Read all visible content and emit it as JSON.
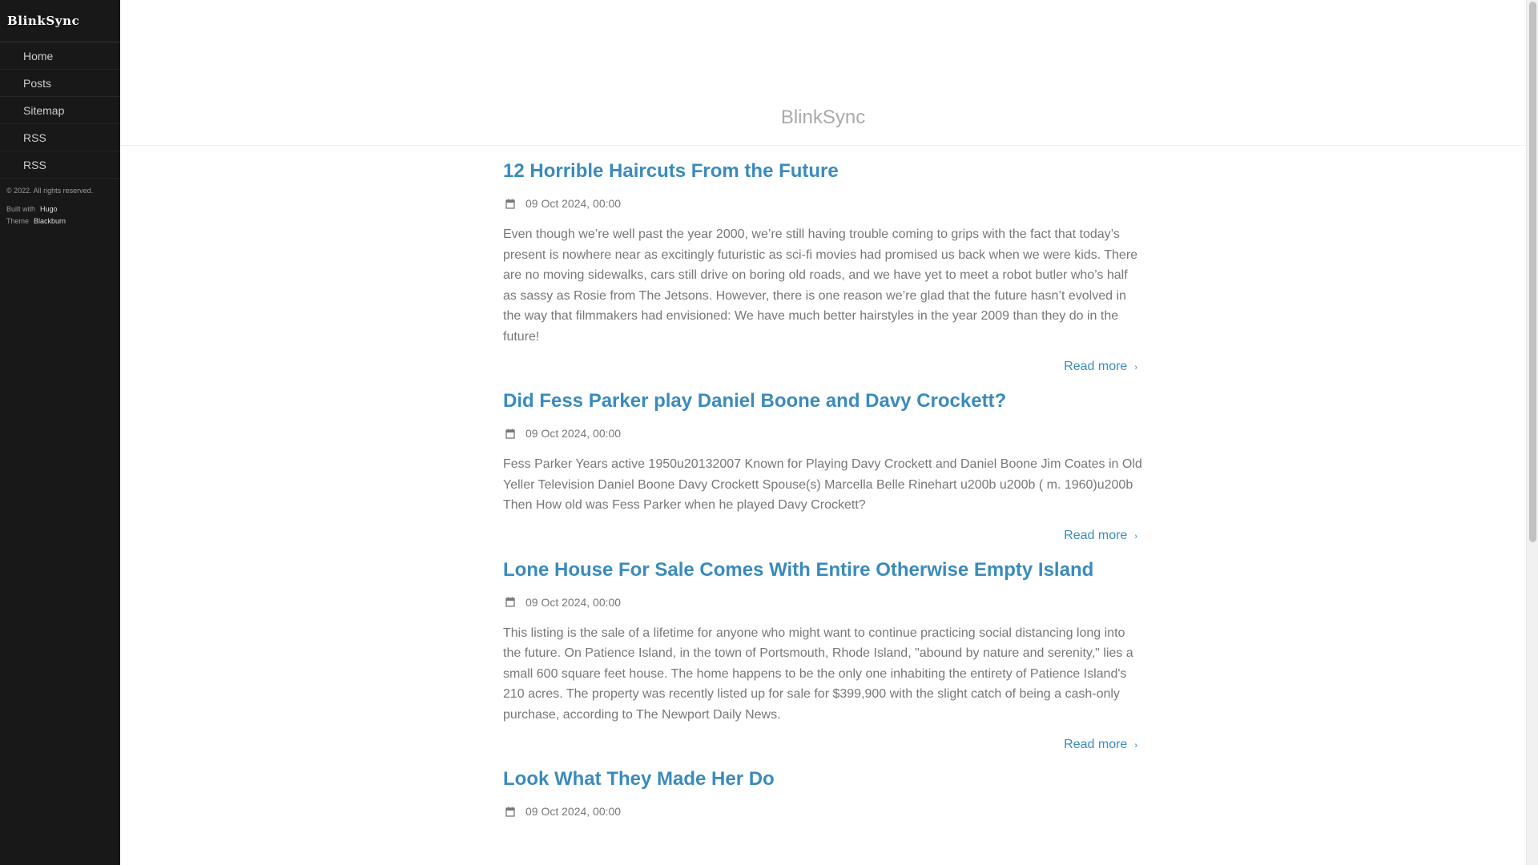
{
  "sidebar": {
    "brand": "BlinkSync",
    "items": [
      {
        "label": "Home",
        "icon": "home-icon"
      },
      {
        "label": "Posts",
        "icon": "list-icon"
      },
      {
        "label": "Sitemap",
        "icon": "sitemap-icon"
      },
      {
        "label": "RSS",
        "icon": "rss-icon"
      },
      {
        "label": "RSS",
        "icon": "rss-icon"
      }
    ],
    "footer": {
      "copyright": "© 2022. All rights reserved.",
      "built_with_label": "Built with",
      "built_with_link": "Hugo",
      "theme_label": "Theme",
      "theme_link": "Blackburn"
    }
  },
  "header": {
    "title": "BlinkSync"
  },
  "posts": [
    {
      "title": "12 Horrible Haircuts From the Future",
      "date": "09 Oct 2024, 00:00",
      "summary": "Even though we’re well past the year 2000, we’re still having trouble coming to grips with the fact that today’s present is nowhere near as excitingly futuristic as sci-fi movies had promised us back when we were kids. There are no moving sidewalks, cars still drive on boring old roads, and we have yet to meet a robot butler who’s half as sassy as Rosie from The Jetsons. However, there is one reason we’re glad that the future hasn’t evolved in the way that filmmakers had envisioned: We have much better hairstyles in the year 2009 than they do in the future!",
      "read_more": "Read more"
    },
    {
      "title": "Did Fess Parker play Daniel Boone and Davy Crockett?",
      "date": "09 Oct 2024, 00:00",
      "summary": "Fess Parker Years active 1950u20132007 Known for Playing Davy Crockett and Daniel Boone Jim Coates in Old Yeller Television Daniel Boone Davy Crockett Spouse(s) Marcella Belle Rinehart u200b u200b ( m. 1960)u200b Then How old was Fess Parker when he played Davy Crockett?",
      "read_more": "Read more"
    },
    {
      "title": "Lone House For Sale Comes With Entire Otherwise Empty Island",
      "date": "09 Oct 2024, 00:00",
      "summary": "This listing is the sale of a lifetime for anyone who might want to continue practicing social distancing long into the future. On Patience Island, in the town of Portsmouth, Rhode Island, \"abound by nature and serenity,\" lies a small 600 square feet house. The home happens to be the only one inhabiting the entirety of Patience Island's 210 acres. The property was recently listed up for sale for $399,900 with the slight catch of being a cash-only purchase, according to The Newport Daily News.",
      "read_more": "Read more"
    },
    {
      "title": "Look What They Made Her Do",
      "date": "09 Oct 2024, 00:00"
    }
  ],
  "colors": {
    "sidebar_bg": "#191818",
    "link": "#3a8bbb",
    "text": "#777777"
  }
}
